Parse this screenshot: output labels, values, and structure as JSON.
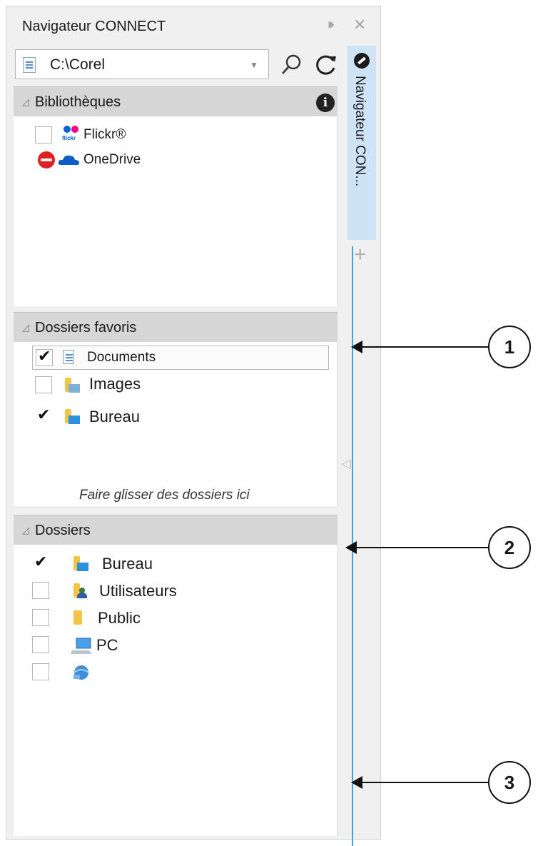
{
  "window": {
    "title": "Navigateur CONNECT",
    "pin_glyph": "⏵⏵",
    "close_glyph": "✕"
  },
  "path": {
    "value": "C:\\Corel",
    "dropdown_glyph": "▼"
  },
  "libraries": {
    "title": "Bibliothèques",
    "info_glyph": "i",
    "items": [
      {
        "label": "Flickr®",
        "checked": false,
        "icon": "flickr-icon"
      },
      {
        "label": "OneDrive",
        "status": "blocked",
        "icon": "onedrive-icon"
      }
    ]
  },
  "favorites": {
    "title": "Dossiers favoris",
    "items": [
      {
        "label": "Documents",
        "checked": true,
        "icon": "documents-icon"
      },
      {
        "label": "Images",
        "checked": false,
        "icon": "images-folder-icon"
      },
      {
        "label": "Bureau",
        "checked": true,
        "icon": "folder-icon"
      }
    ],
    "drop_hint": "Faire glisser des dossiers ici"
  },
  "folders": {
    "title": "Dossiers",
    "items": [
      {
        "label": "Bureau",
        "checked": true,
        "icon": "folder-icon"
      },
      {
        "label": "Utilisateurs",
        "checked": false,
        "icon": "users-folder-icon"
      },
      {
        "label": "Public",
        "checked": false,
        "icon": "folder-icon"
      },
      {
        "label": "PC",
        "checked": false,
        "icon": "computer-icon"
      },
      {
        "label": "",
        "checked": false,
        "icon": "network-icon"
      }
    ]
  },
  "side_tab": {
    "label": "Navigateur CON...",
    "add_glyph": "+"
  },
  "callouts": [
    "1",
    "2",
    "3"
  ],
  "glyphs": {
    "check": "✔",
    "tri": "◿",
    "collapse": "◁"
  },
  "colors": {
    "accent": "#3fa4e6",
    "tab_bg": "#cfe3f7",
    "header_bg": "#d6d6d6",
    "folder_blue": "#2d8fe0",
    "folder_yellow": "#f3c546"
  }
}
